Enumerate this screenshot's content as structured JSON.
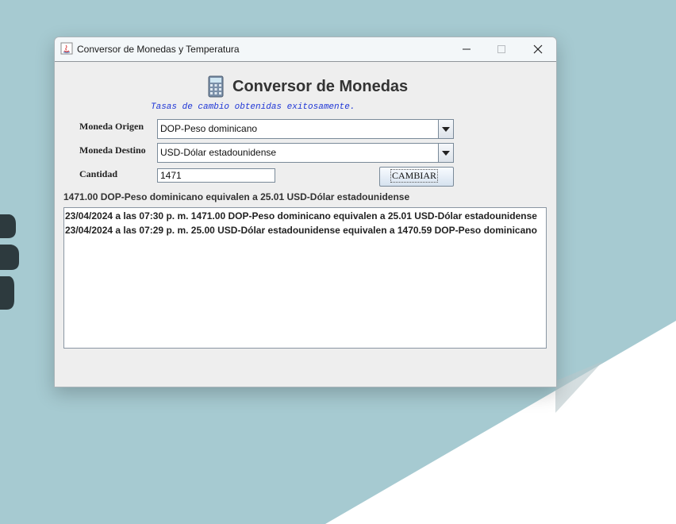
{
  "window": {
    "title": "Conversor de Monedas y Temperatura",
    "controls": {
      "minimize": "minimize-icon",
      "maximize": "maximize-icon",
      "close": "close-icon"
    }
  },
  "header": {
    "title": "Conversor de Monedas",
    "icon": "calculator-icon"
  },
  "status": "Tasas de cambio obtenidas exitosamente.",
  "form": {
    "origin_label": "Moneda Origen",
    "origin_value": "DOP-Peso dominicano",
    "destination_label": "Moneda Destino",
    "destination_value": "USD-Dólar estadounidense",
    "quantity_label": "Cantidad",
    "quantity_value": "1471",
    "button_label": "CAMBIAR"
  },
  "result": "1471.00 DOP-Peso dominicano equivalen a 25.01 USD-Dólar estadounidense",
  "history": [
    "23/04/2024 a las 07:30 p. m. 1471.00 DOP-Peso dominicano equivalen a 25.01 USD-Dólar estadounidense",
    "23/04/2024 a las 07:29 p. m. 25.00 USD-Dólar estadounidense equivalen a 1470.59 DOP-Peso dominicano"
  ],
  "colors": {
    "desktop": "#a6cad1",
    "status_text": "#1f36d6",
    "window_bg": "#eeeeee"
  }
}
